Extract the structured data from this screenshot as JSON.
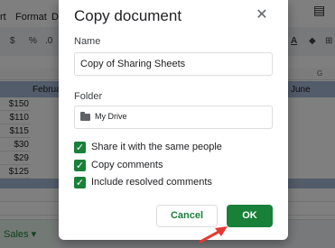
{
  "menubar": {
    "items": [
      "rt",
      "Format",
      "D"
    ]
  },
  "toolbar": {
    "items": [
      "$",
      "%",
      ".0"
    ]
  },
  "columns": {
    "g": "G"
  },
  "sheet_header": {
    "february": "Februa",
    "june": "June"
  },
  "cells": [
    "$150",
    "$110",
    "$115",
    "$30",
    "$29",
    "$125"
  ],
  "sheet_tab": {
    "label": "Sales ▾"
  },
  "dialog": {
    "title": "Copy document",
    "close_glyph": "✕",
    "name_label": "Name",
    "name_value": "Copy of Sharing Sheets",
    "folder_label": "Folder",
    "folder_value": "My Drive",
    "options": [
      {
        "label": "Share it with the same people",
        "checked": true
      },
      {
        "label": "Copy comments",
        "checked": true
      },
      {
        "label": "Include resolved comments",
        "checked": true
      }
    ],
    "checkbox_glyph": "✓",
    "cancel_label": "Cancel",
    "ok_label": "OK"
  },
  "colors": {
    "accent": "#188038",
    "overlay": "rgba(0,0,0,0.5)",
    "arrow": "#e53935"
  }
}
